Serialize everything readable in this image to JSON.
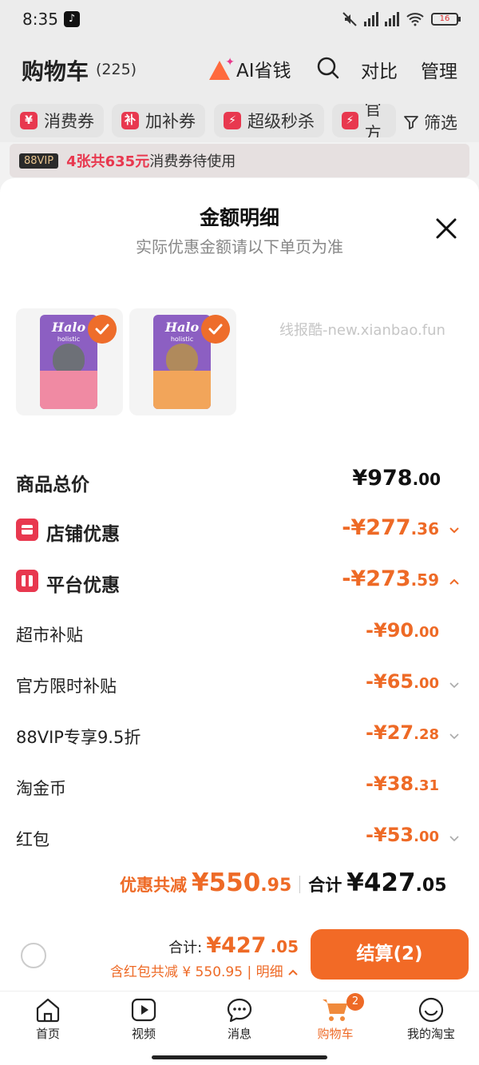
{
  "status_bar": {
    "time": "8:35",
    "battery": "16"
  },
  "header": {
    "title": "购物车",
    "count": "(225)",
    "ai_label": "AI省钱",
    "compare": "对比",
    "manage": "管理"
  },
  "chips": [
    {
      "icon_text": "¥",
      "label": "消费券"
    },
    {
      "icon_text": "补",
      "label": "加补券"
    },
    {
      "icon_text": "⚡",
      "label": "超级秒杀"
    },
    {
      "icon_text": "⚡",
      "label": "官方"
    }
  ],
  "filter_label": "筛选",
  "vip_bar": {
    "tag": "88VIP",
    "highlight": "4张共635元",
    "text": "消费券待使用"
  },
  "sheet": {
    "title": "金额明细",
    "subtitle": "实际优惠金额请以下单页为准",
    "watermark": "线报酷-new.xianbao.fun",
    "products": [
      {
        "brand": "Halo",
        "line": "holistic",
        "colors": {
          "bag": "#8c5fc2",
          "lower": "#f08aa3"
        }
      },
      {
        "brand": "Halo",
        "line": "holistic",
        "colors": {
          "bag": "#8c5fc2",
          "lower": "#f2a55a"
        }
      }
    ],
    "rows": {
      "total": {
        "label": "商品总价",
        "int": "¥978",
        "dec": ".00"
      },
      "shop": {
        "label": "店铺优惠",
        "int": "-¥277",
        "dec": ".36"
      },
      "platform": {
        "label": "平台优惠",
        "int": "-¥273",
        "dec": ".59"
      },
      "supermarket": {
        "label": "超市补贴",
        "int": "-¥90",
        "dec": ".00"
      },
      "official": {
        "label": "官方限时补贴",
        "int": "-¥65",
        "dec": ".00"
      },
      "vip": {
        "label": "88VIP专享9.5折",
        "int": "-¥27",
        "dec": ".28"
      },
      "coins": {
        "label": "淘金币",
        "int": "-¥38",
        "dec": ".31"
      },
      "redpacket": {
        "label": "红包",
        "int": "-¥53",
        "dec": ".00"
      }
    },
    "summary": {
      "discount_label": "优惠共减",
      "discount_int": "¥550",
      "discount_dec": ".95",
      "total_label": "合计",
      "total_int": "¥427",
      "total_dec": ".05"
    }
  },
  "checkout": {
    "total_label": "合计:",
    "total_int": "¥427",
    "total_dec": ".05",
    "discount_text": "含红包共减 ¥ 550.95 | 明细",
    "pay_label": "结算(2)"
  },
  "tabs": [
    {
      "label": "首页",
      "icon": "home-icon"
    },
    {
      "label": "视频",
      "icon": "video-icon"
    },
    {
      "label": "消息",
      "icon": "message-icon"
    },
    {
      "label": "购物车",
      "icon": "cart-icon",
      "badge": "2"
    },
    {
      "label": "我的淘宝",
      "icon": "profile-icon"
    }
  ],
  "colors": {
    "accent": "#ee6a26",
    "red": "#e8384f"
  }
}
